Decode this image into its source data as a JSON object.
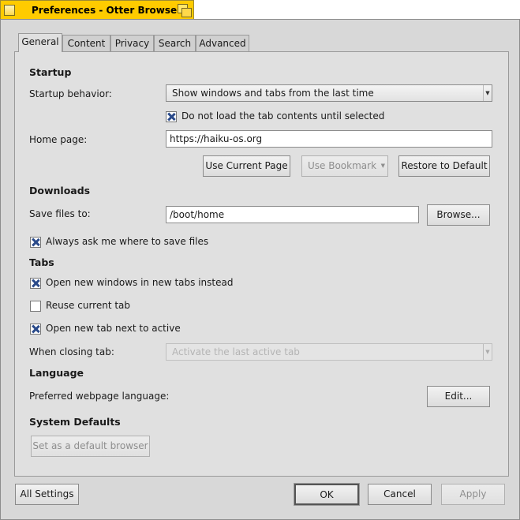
{
  "window": {
    "title": "Preferences - Otter Browser"
  },
  "tabs": [
    {
      "label": "General",
      "active": true
    },
    {
      "label": "Content",
      "active": false
    },
    {
      "label": "Privacy",
      "active": false
    },
    {
      "label": "Search",
      "active": false
    },
    {
      "label": "Advanced",
      "active": false
    }
  ],
  "startup": {
    "heading": "Startup",
    "behavior_label": "Startup behavior:",
    "behavior_value": "Show windows and tabs from the last time",
    "lazy_load_label": "Do not load the tab contents until selected",
    "lazy_load_checked": true,
    "home_label": "Home page:",
    "home_value": "https://haiku-os.org",
    "use_current_label": "Use Current Page",
    "use_bookmark_label": "Use Bookmark",
    "restore_label": "Restore to Default"
  },
  "downloads": {
    "heading": "Downloads",
    "save_label": "Save files to:",
    "save_value": "/boot/home",
    "browse_label": "Browse...",
    "ask_label": "Always ask me where to save files",
    "ask_checked": true
  },
  "tabs_section": {
    "heading": "Tabs",
    "open_new_windows_label": "Open new windows in new tabs instead",
    "open_new_windows_checked": true,
    "reuse_label": "Reuse current tab",
    "reuse_checked": false,
    "next_to_active_label": "Open new tab next to active",
    "next_to_active_checked": true,
    "closing_label": "When closing tab:",
    "closing_value": "Activate the last active tab"
  },
  "language": {
    "heading": "Language",
    "preferred_label": "Preferred webpage language:",
    "edit_label": "Edit..."
  },
  "system": {
    "heading": "System Defaults",
    "default_browser_label": "Set as a default browser"
  },
  "footer": {
    "all_settings_label": "All Settings",
    "ok_label": "OK",
    "cancel_label": "Cancel",
    "apply_label": "Apply"
  },
  "colors": {
    "title_tab": "#ffcb00",
    "window_bg": "#d8d8d8",
    "check_mark": "#2a4a8a"
  }
}
